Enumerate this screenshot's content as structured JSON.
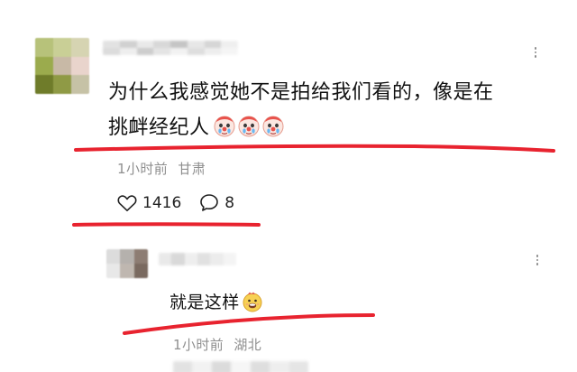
{
  "comment": {
    "line1": "为什么我感觉她不是拍给我们看的，像是在",
    "line2": "挑衅经纪人",
    "emoji": "crying-clown-emoji",
    "emoji_count": 3,
    "time": "1小时前",
    "location": "甘肃",
    "likes": "1416",
    "replies": "8"
  },
  "reply": {
    "text": "就是这样",
    "emoji": "grinning-face-emoji",
    "time": "1小时前",
    "location": "湖北"
  },
  "icons": {
    "like": "heart-icon",
    "comment": "speech-bubble-icon",
    "more": "more-dots-icon"
  },
  "colors": {
    "annotation_red": "#e8232f",
    "meta_gray": "#8f8f8f",
    "text": "#111111",
    "background": "#ffffff"
  }
}
